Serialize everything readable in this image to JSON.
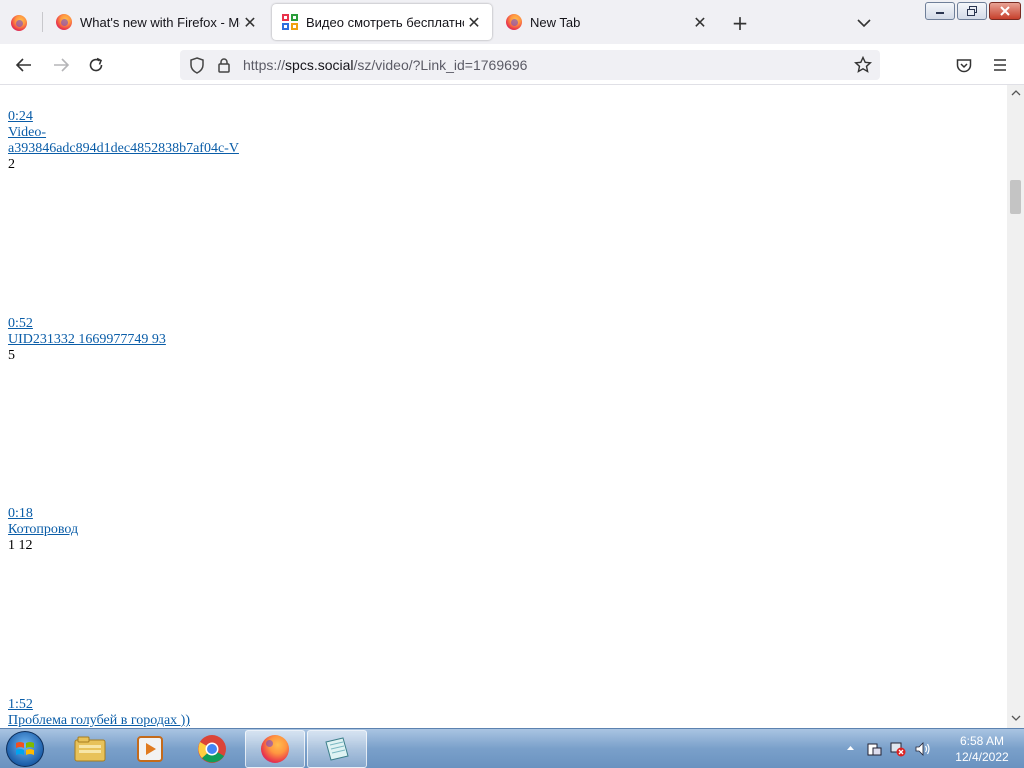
{
  "browser": {
    "tabs": [
      {
        "label": "What's new with Firefox - More",
        "active": false
      },
      {
        "label": "Видео смотреть бесплатно онлайн",
        "active": true
      },
      {
        "label": "New Tab",
        "active": false
      }
    ],
    "url": {
      "scheme": "https://",
      "host": "spcs.social",
      "path": "/sz/video/?Link_id=1769696"
    }
  },
  "videos": [
    {
      "duration": "0:24",
      "title_line1": "Video-",
      "title_line2": "a393846adc894d1dec4852838b7af04c-V",
      "views": "2"
    },
    {
      "duration": "0:52",
      "title_line1": "UID231332 1669977749 93",
      "title_line2": "",
      "views": "5"
    },
    {
      "duration": "0:18",
      "title_line1": "Котопровод",
      "title_line2": "",
      "views": "1 12"
    },
    {
      "duration": "1:52",
      "title_line1": "Проблема голубей в городах ))",
      "title_line2": "",
      "views": ""
    }
  ],
  "taskbar": {
    "time": "6:58 AM",
    "date": "12/4/2022",
    "apps": [
      "explorer",
      "media-player",
      "chrome",
      "firefox",
      "notepad"
    ]
  },
  "colors": {
    "link": "#0a5da8",
    "tabstrip": "#f0f0f4",
    "taskbar": "#7aa0ca"
  }
}
